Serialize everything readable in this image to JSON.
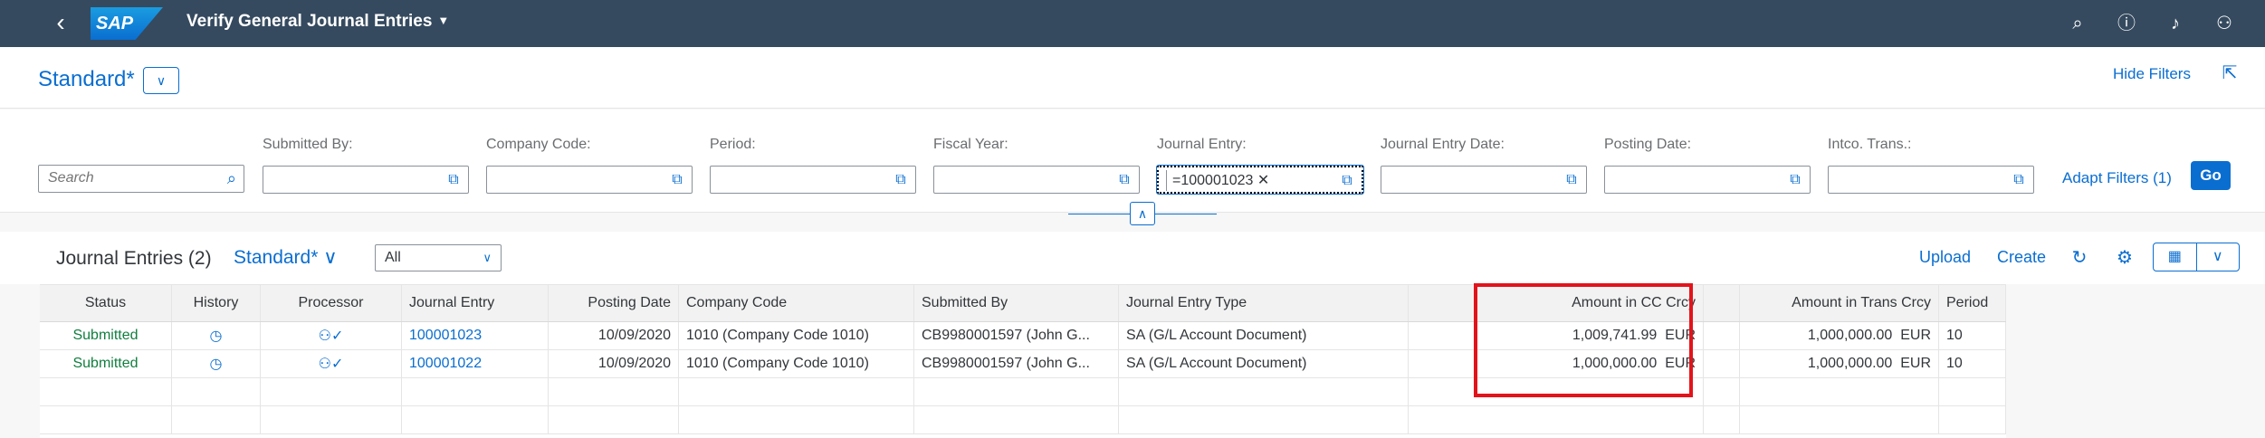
{
  "shell": {
    "logo": "SAP",
    "title": "Verify General Journal Entries",
    "icons": [
      "back-icon",
      "search-icon",
      "help-icon",
      "bell-icon",
      "user-icon"
    ]
  },
  "variant": {
    "name": "Standard*",
    "hide_filters": "Hide Filters"
  },
  "filters": {
    "search_placeholder": "Search",
    "fields": [
      {
        "label": "Submitted By:",
        "value": ""
      },
      {
        "label": "Company Code:",
        "value": ""
      },
      {
        "label": "Period:",
        "value": ""
      },
      {
        "label": "Fiscal Year:",
        "value": ""
      },
      {
        "label": "Journal Entry:",
        "value": "=100001023"
      },
      {
        "label": "Journal Entry Date:",
        "value": ""
      },
      {
        "label": "Posting Date:",
        "value": ""
      },
      {
        "label": "Intco. Trans.:",
        "value": ""
      }
    ],
    "adapt": "Adapt Filters (1)",
    "go": "Go"
  },
  "table": {
    "title": "Journal Entries (2)",
    "variant": "Standard*",
    "select_value": "All",
    "upload": "Upload",
    "create": "Create",
    "columns": [
      "Status",
      "History",
      "Processor",
      "Journal Entry",
      "Posting Date",
      "Company Code",
      "Submitted By",
      "Journal Entry Type",
      "Amount in CC Crcy",
      "Amount in Trans Crcy",
      "Period"
    ],
    "rows": [
      {
        "status": "Submitted",
        "journal_entry": "100001023",
        "posting_date": "10/09/2020",
        "company_code": "1010 (Company Code 1010)",
        "submitted_by": "CB9980001597 (John G...",
        "type": "SA (G/L Account Document)",
        "amount_cc": "1,009,741.99",
        "cc_cur": "EUR",
        "amount_trans": "1,000,000.00",
        "trans_cur": "EUR",
        "period": "10"
      },
      {
        "status": "Submitted",
        "journal_entry": "100001022",
        "posting_date": "10/09/2020",
        "company_code": "1010 (Company Code 1010)",
        "submitted_by": "CB9980001597 (John G...",
        "type": "SA (G/L Account Document)",
        "amount_cc": "1,000,000.00",
        "cc_cur": "EUR",
        "amount_trans": "1,000,000.00",
        "trans_cur": "EUR",
        "period": "10"
      }
    ]
  },
  "colors": {
    "shell": "#354a5f",
    "accent": "#0a6ed1",
    "success": "#107e3e",
    "highlight": "#e3131b"
  }
}
